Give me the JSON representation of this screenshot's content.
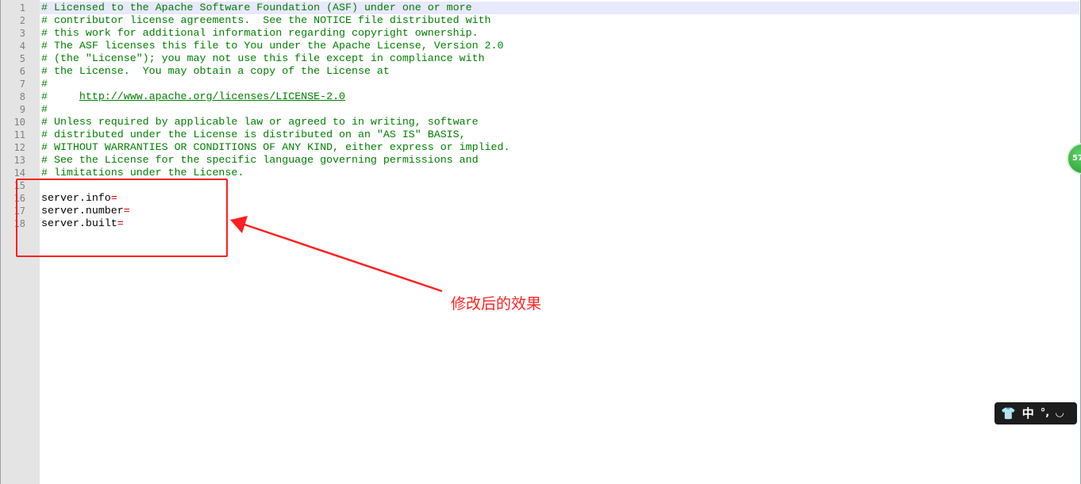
{
  "editor": {
    "line_numbers": [
      "1",
      "2",
      "3",
      "4",
      "5",
      "6",
      "7",
      "8",
      "9",
      "10",
      "11",
      "12",
      "13",
      "14",
      "15",
      "16",
      "17",
      "18"
    ],
    "lines": [
      {
        "type": "comment",
        "text": "# Licensed to the Apache Software Foundation (ASF) under one or more"
      },
      {
        "type": "comment",
        "text": "# contributor license agreements.  See the NOTICE file distributed with"
      },
      {
        "type": "comment",
        "text": "# this work for additional information regarding copyright ownership."
      },
      {
        "type": "comment",
        "text": "# The ASF licenses this file to You under the Apache License, Version 2.0"
      },
      {
        "type": "comment",
        "text": "# (the \"License\"); you may not use this file except in compliance with"
      },
      {
        "type": "comment",
        "text": "# the License.  You may obtain a copy of the License at"
      },
      {
        "type": "comment",
        "text": "#"
      },
      {
        "type": "comment_url",
        "prefix": "#     ",
        "url": "http://www.apache.org/licenses/LICENSE-2.0"
      },
      {
        "type": "comment",
        "text": "#"
      },
      {
        "type": "comment",
        "text": "# Unless required by applicable law or agreed to in writing, software"
      },
      {
        "type": "comment",
        "text": "# distributed under the License is distributed on an \"AS IS\" BASIS,"
      },
      {
        "type": "comment",
        "text": "# WITHOUT WARRANTIES OR CONDITIONS OF ANY KIND, either express or implied."
      },
      {
        "type": "comment",
        "text": "# See the License for the specific language governing permissions and"
      },
      {
        "type": "comment",
        "text": "# limitations under the License."
      },
      {
        "type": "empty",
        "text": ""
      },
      {
        "type": "property",
        "key": "server.info",
        "op": "="
      },
      {
        "type": "property",
        "key": "server.number",
        "op": "="
      },
      {
        "type": "property",
        "key": "server.built",
        "op": "="
      }
    ],
    "colors": {
      "comment": "#008000",
      "property_key": "#000000",
      "operator": "#cc0000",
      "gutter_bg": "#e4e4e4",
      "current_line_bg": "#e8e8ff"
    }
  },
  "annotation": {
    "text": "修改后的效果",
    "color": "#ff2020"
  },
  "side_widget": {
    "label": "57",
    "color": "#2fae3a"
  },
  "ime_toolbar": {
    "items": [
      {
        "icon": "shirt-icon",
        "glyph": "👕"
      },
      {
        "icon": "chinese-mode-icon",
        "glyph": "中"
      },
      {
        "icon": "punctuation-icon",
        "glyph": "°,"
      },
      {
        "icon": "half-width-icon",
        "glyph": "◡"
      }
    ]
  }
}
